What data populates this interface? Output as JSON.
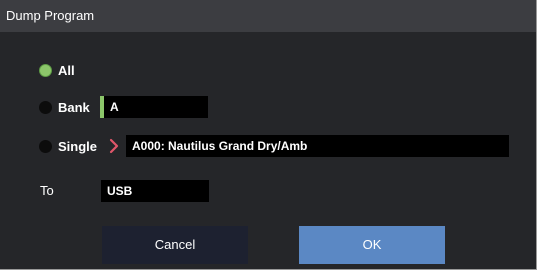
{
  "dialog": {
    "title": "Dump Program"
  },
  "options": {
    "all_label": "All",
    "bank_label": "Bank",
    "single_label": "Single",
    "selected": "All"
  },
  "fields": {
    "bank_value": "A",
    "single_value": "A000: Nautilus Grand Dry/Amb",
    "to_label": "To",
    "to_value": "USB"
  },
  "buttons": {
    "cancel_label": "Cancel",
    "ok_label": "OK"
  },
  "colors": {
    "selected_radio": "#8cc66a",
    "chevron": "#e0566a",
    "ok_button": "#5b88c4",
    "cancel_button": "#1d2130"
  }
}
